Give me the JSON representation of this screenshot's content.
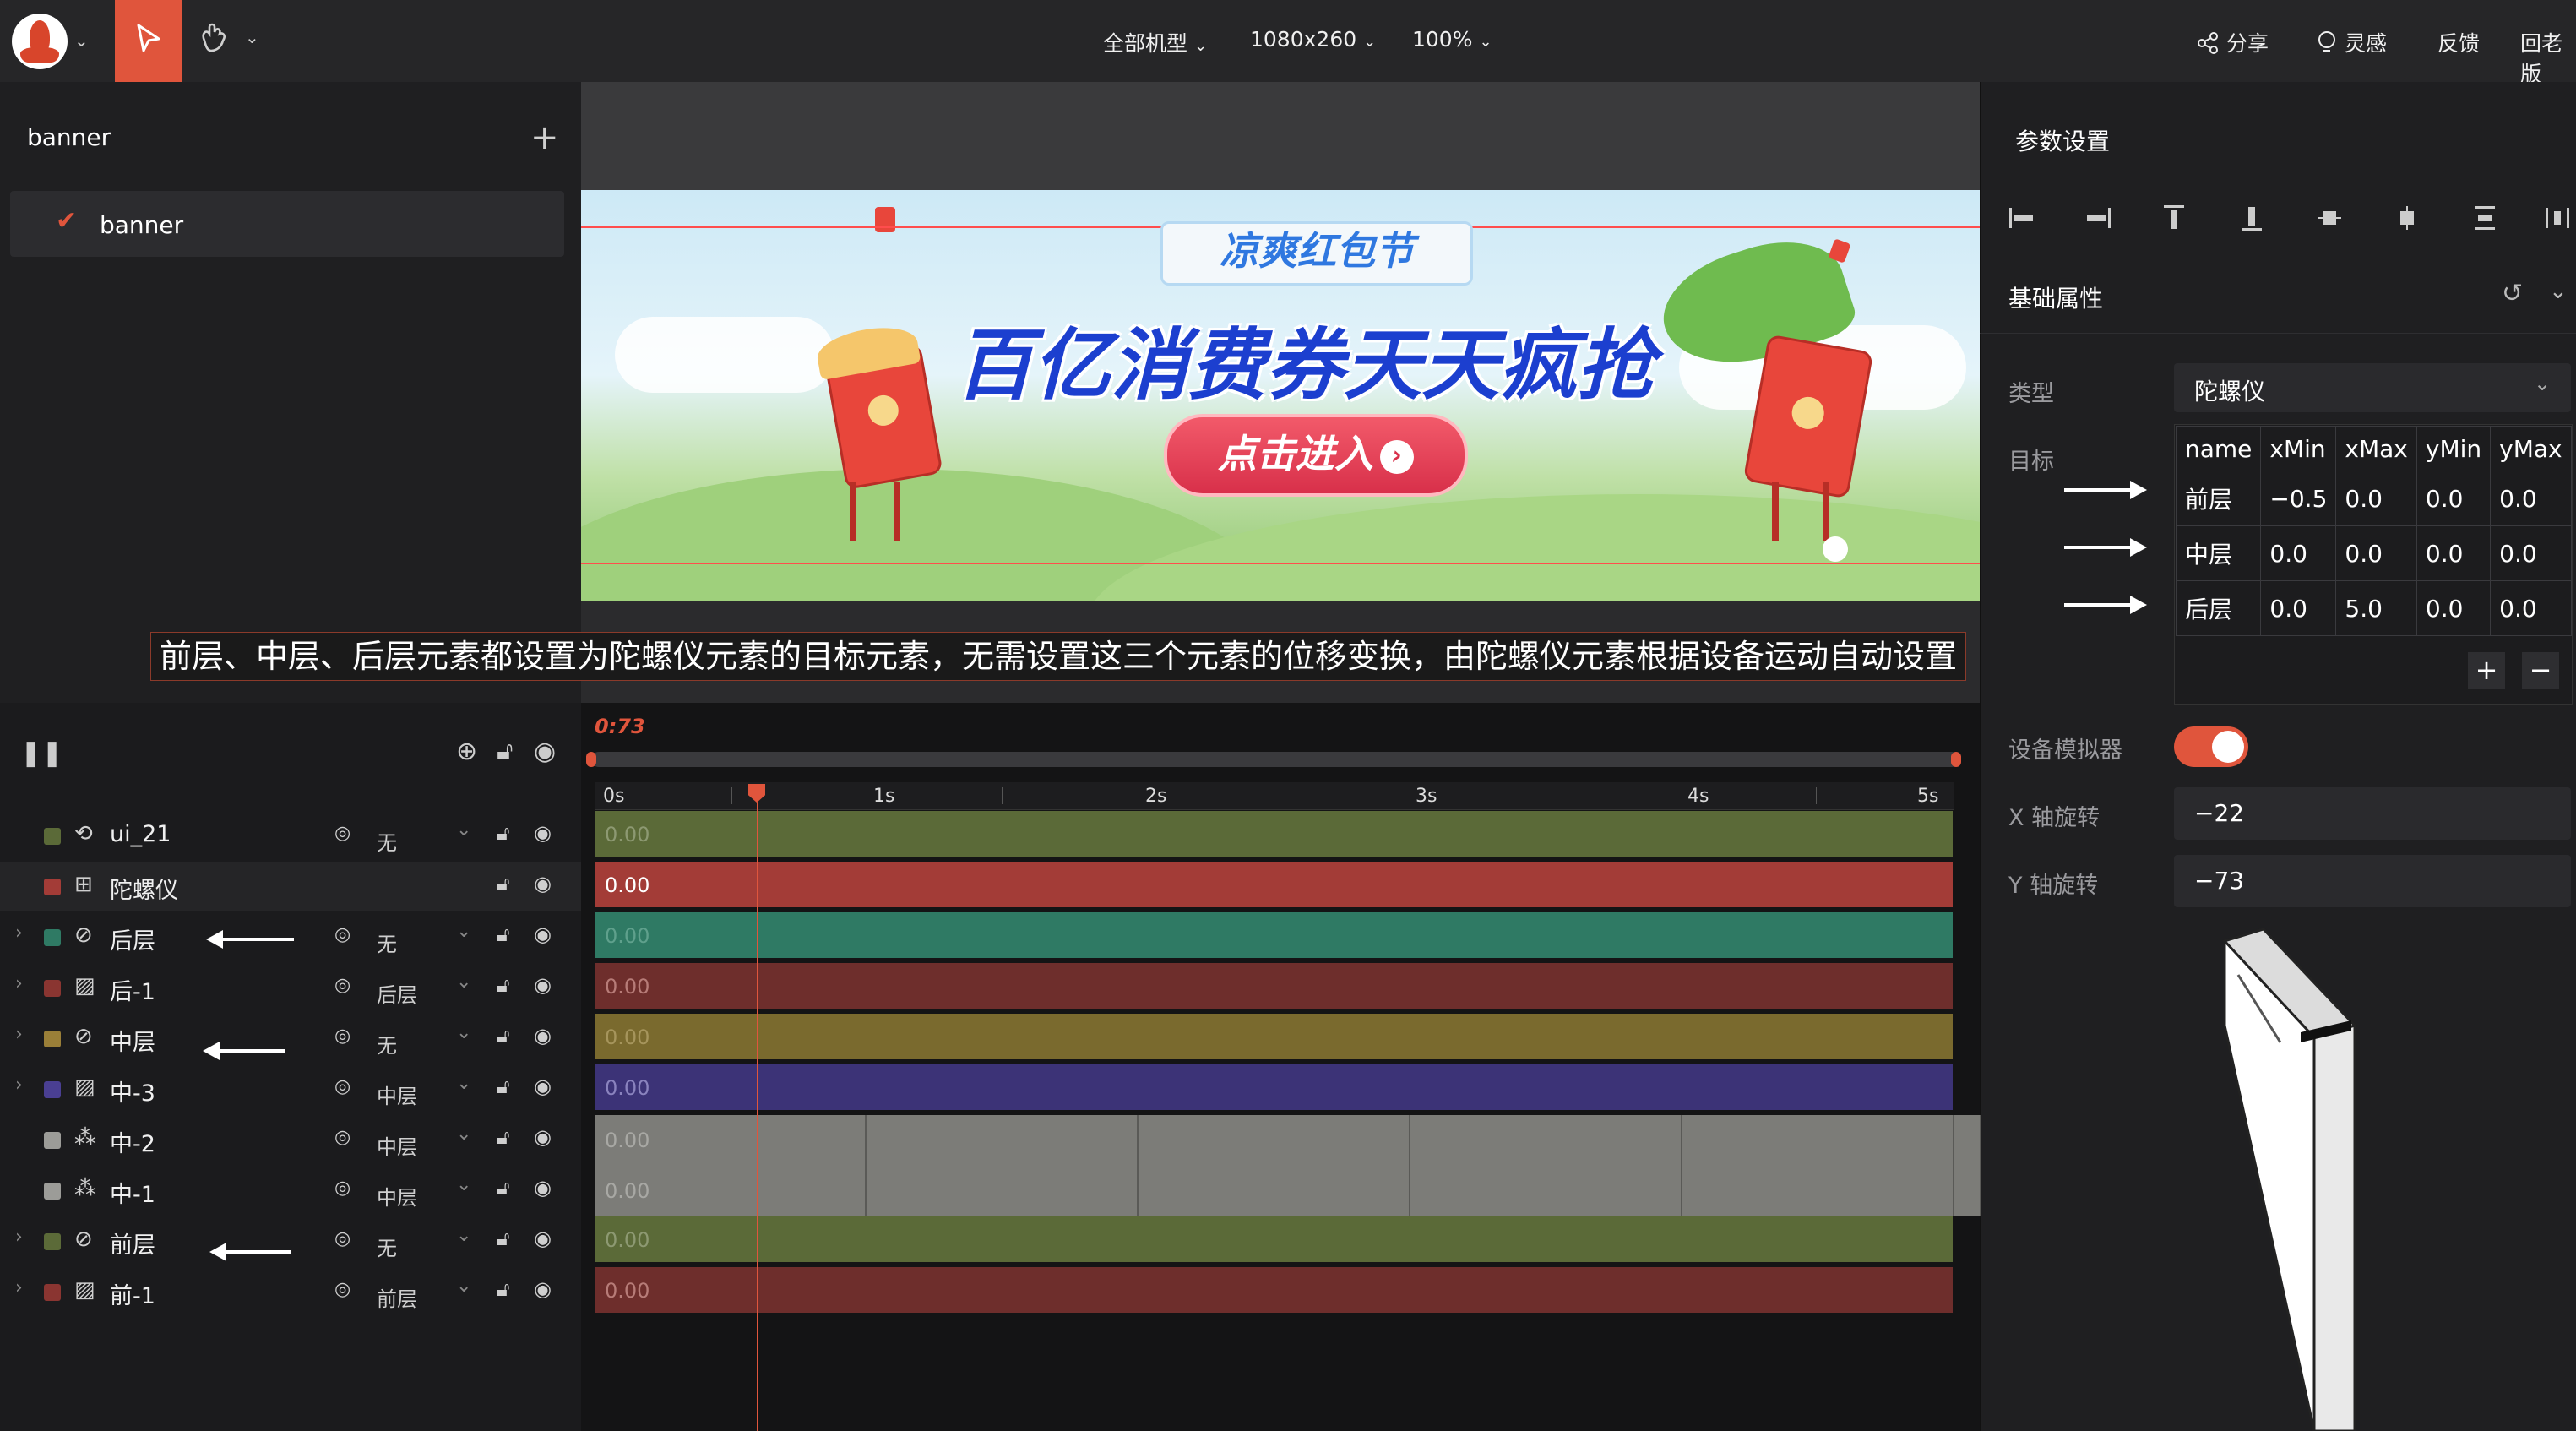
{
  "topbar": {
    "device": "全部机型",
    "resolution": "1080x260",
    "zoom": "100%",
    "share": "分享",
    "inspiration": "灵感",
    "feedback": "反馈",
    "old_version": "回老版"
  },
  "left_panel": {
    "title": "banner",
    "items": [
      {
        "label": "banner",
        "selected": true
      }
    ]
  },
  "banner": {
    "tag": "凉爽红包节",
    "headline": "百亿消费券天天疯抢",
    "cta": "点击进入"
  },
  "caption": "前层、中层、后层元素都设置为陀螺仪元素的目标元素，无需设置这三个元素的位移变换，由陀螺仪元素根据设备运动自动设置",
  "right_panel": {
    "title": "参数设置",
    "section": "基础属性",
    "type_label": "类型",
    "type_value": "陀螺仪",
    "target_label": "目标",
    "target_table": {
      "headers": [
        "name",
        "xMin",
        "xMax",
        "yMin",
        "yMax"
      ],
      "rows": [
        [
          "前层",
          "−0.5",
          "0.0",
          "0.0",
          "0.0"
        ],
        [
          "中层",
          "0.0",
          "0.0",
          "0.0",
          "0.0"
        ],
        [
          "后层",
          "0.0",
          "5.0",
          "0.0",
          "0.0"
        ]
      ]
    },
    "add": "+",
    "remove": "−",
    "simulator_label": "设备模拟器",
    "simulator_on": true,
    "x_rot_label": "X 轴旋转",
    "x_rot_value": "−22",
    "y_rot_label": "Y 轴旋转",
    "y_rot_value": "−73"
  },
  "timeline": {
    "current_time": "0:73",
    "ticks": [
      "0s",
      "1s",
      "2s",
      "3s",
      "4s",
      "5s"
    ],
    "layers": [
      {
        "name": "ui_21",
        "target": "无",
        "value": "0.00"
      },
      {
        "name": "陀螺仪",
        "target": "",
        "value": "0.00"
      },
      {
        "name": "后层",
        "target": "无",
        "value": "0.00"
      },
      {
        "name": "后-1",
        "target": "后层",
        "value": "0.00"
      },
      {
        "name": "中层",
        "target": "无",
        "value": "0.00"
      },
      {
        "name": "中-3",
        "target": "中层",
        "value": "0.00"
      },
      {
        "name": "中-2",
        "target": "中层",
        "value": "0.00"
      },
      {
        "name": "中-1",
        "target": "中层",
        "value": "0.00"
      },
      {
        "name": "前层",
        "target": "无",
        "value": "0.00"
      },
      {
        "name": "前-1",
        "target": "前层",
        "value": "0.00"
      }
    ]
  },
  "colors": {
    "accent": "#e0553c",
    "track_green": "#5b6a38",
    "track_red": "#a33c37",
    "track_teal": "#2f7a64",
    "track_darkred": "#6e2e2c",
    "track_olive": "#7a6a2e",
    "track_purple": "#3c3377",
    "track_gray": "#7c7c78"
  }
}
